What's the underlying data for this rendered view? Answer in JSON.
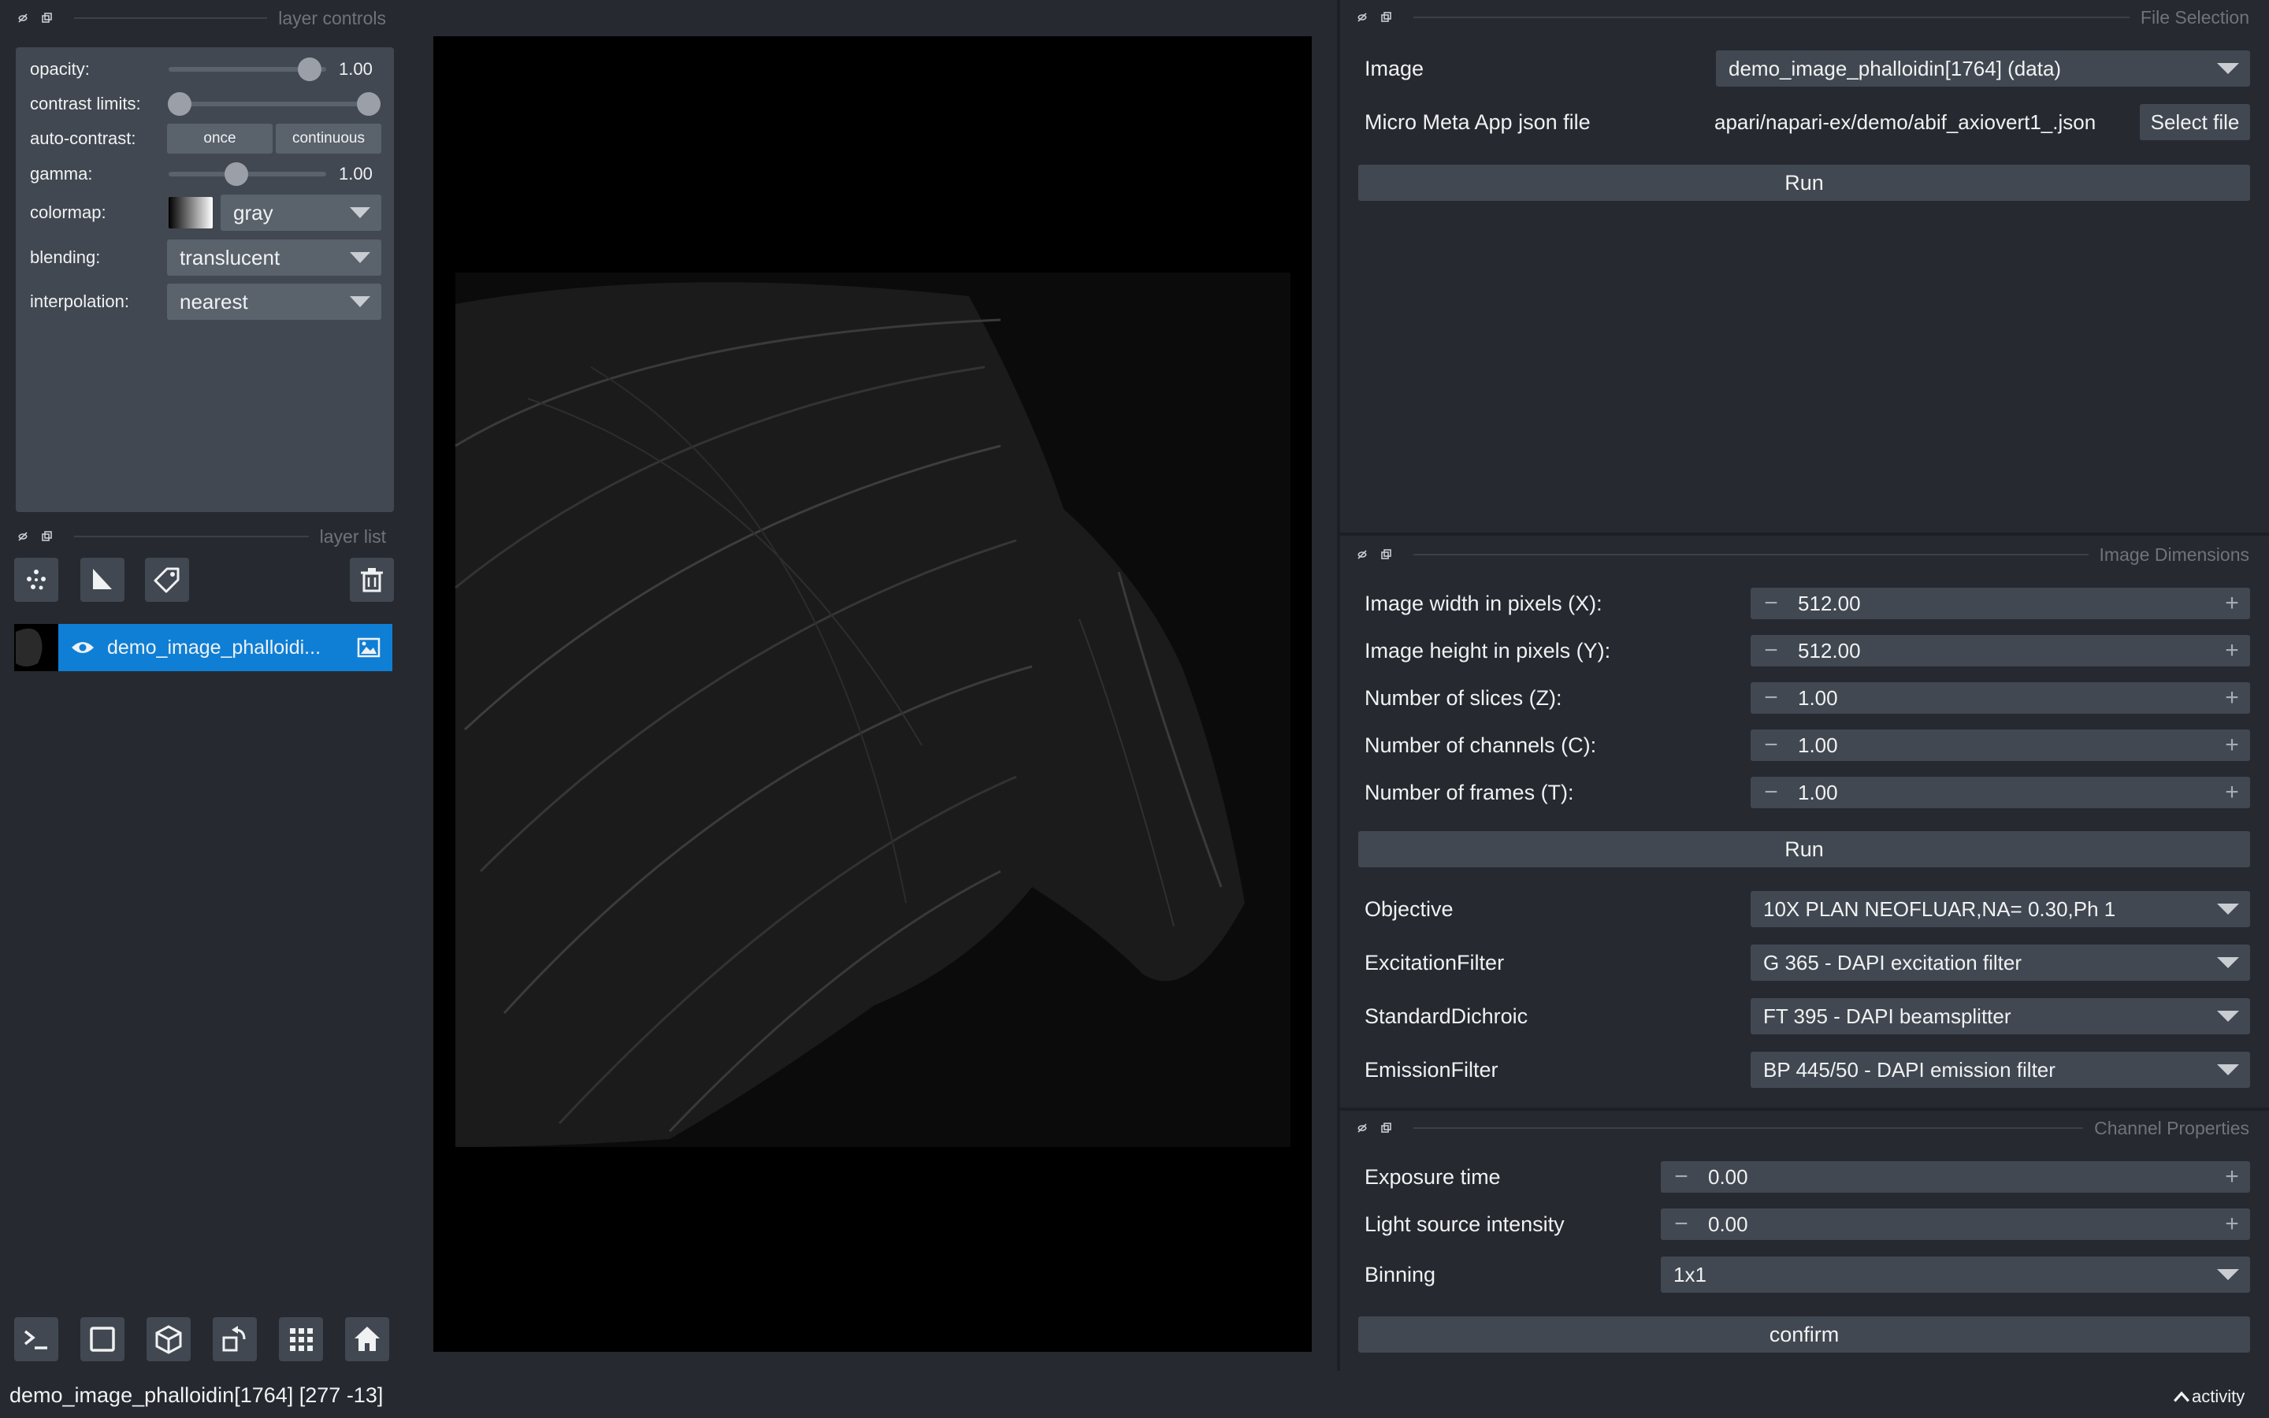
{
  "layer_controls": {
    "title": "layer controls",
    "opacity": {
      "label": "opacity:",
      "value": "1.00",
      "level": 1.0
    },
    "contrast_limits": {
      "label": "contrast limits:",
      "low": 0.0,
      "high": 1.0
    },
    "auto_contrast": {
      "label": "auto-contrast:",
      "once": "once",
      "continuous": "continuous"
    },
    "gamma": {
      "label": "gamma:",
      "value": "1.00",
      "level": 0.45
    },
    "colormap": {
      "label": "colormap:",
      "value": "gray"
    },
    "blending": {
      "label": "blending:",
      "value": "translucent"
    },
    "interpolation": {
      "label": "interpolation:",
      "value": "nearest"
    }
  },
  "layer_list": {
    "title": "layer list",
    "tools": [
      "points-icon",
      "shapes-icon",
      "labels-icon"
    ],
    "delete": "trash-icon",
    "layers": [
      {
        "name": "demo_image_phalloidi...",
        "visible": true,
        "type_icon": "image-icon"
      }
    ]
  },
  "bottom_bar": {
    "buttons": [
      "console-icon",
      "ndisplay-icon",
      "3d-cube-icon",
      "roll-icon",
      "grid-icon",
      "home-icon"
    ]
  },
  "status_bar": {
    "text": "demo_image_phalloidin[1764] [277 -13]",
    "activity": "activity"
  },
  "file_selection": {
    "title": "File Selection",
    "image_label": "Image",
    "image_value": "demo_image_phalloidin[1764] (data)",
    "json_label": "Micro Meta App json file",
    "json_value": "apari/napari-ex/demo/abif_axiovert1_.json",
    "select_file": "Select file",
    "run": "Run"
  },
  "image_dimensions": {
    "title": "Image Dimensions",
    "fields": [
      {
        "label": "Image width in pixels (X):",
        "value": "512.00"
      },
      {
        "label": "Image height in pixels (Y):",
        "value": "512.00"
      },
      {
        "label": "Number of slices (Z):",
        "value": "1.00"
      },
      {
        "label": "Number of channels (C):",
        "value": "1.00"
      },
      {
        "label": "Number of frames (T):",
        "value": "1.00"
      }
    ],
    "run": "Run",
    "selects": [
      {
        "label": "Objective",
        "value": "10X PLAN NEOFLUAR,NA= 0.30,Ph 1"
      },
      {
        "label": "ExcitationFilter",
        "value": "G 365 - DAPI excitation filter"
      },
      {
        "label": "StandardDichroic",
        "value": "FT 395 - DAPI beamsplitter"
      },
      {
        "label": "EmissionFilter",
        "value": "BP 445/50 - DAPI emission filter"
      }
    ]
  },
  "channel_properties": {
    "title": "Channel Properties",
    "exposure_label": "Exposure time",
    "exposure_value": "0.00",
    "intensity_label": "Light source intensity",
    "intensity_value": "0.00",
    "binning_label": "Binning",
    "binning_value": "1x1",
    "confirm": "confirm"
  },
  "colors": {
    "background": "#262930",
    "panel": "#414851",
    "selected": "#0e7fd5",
    "canvas": "#000000"
  }
}
